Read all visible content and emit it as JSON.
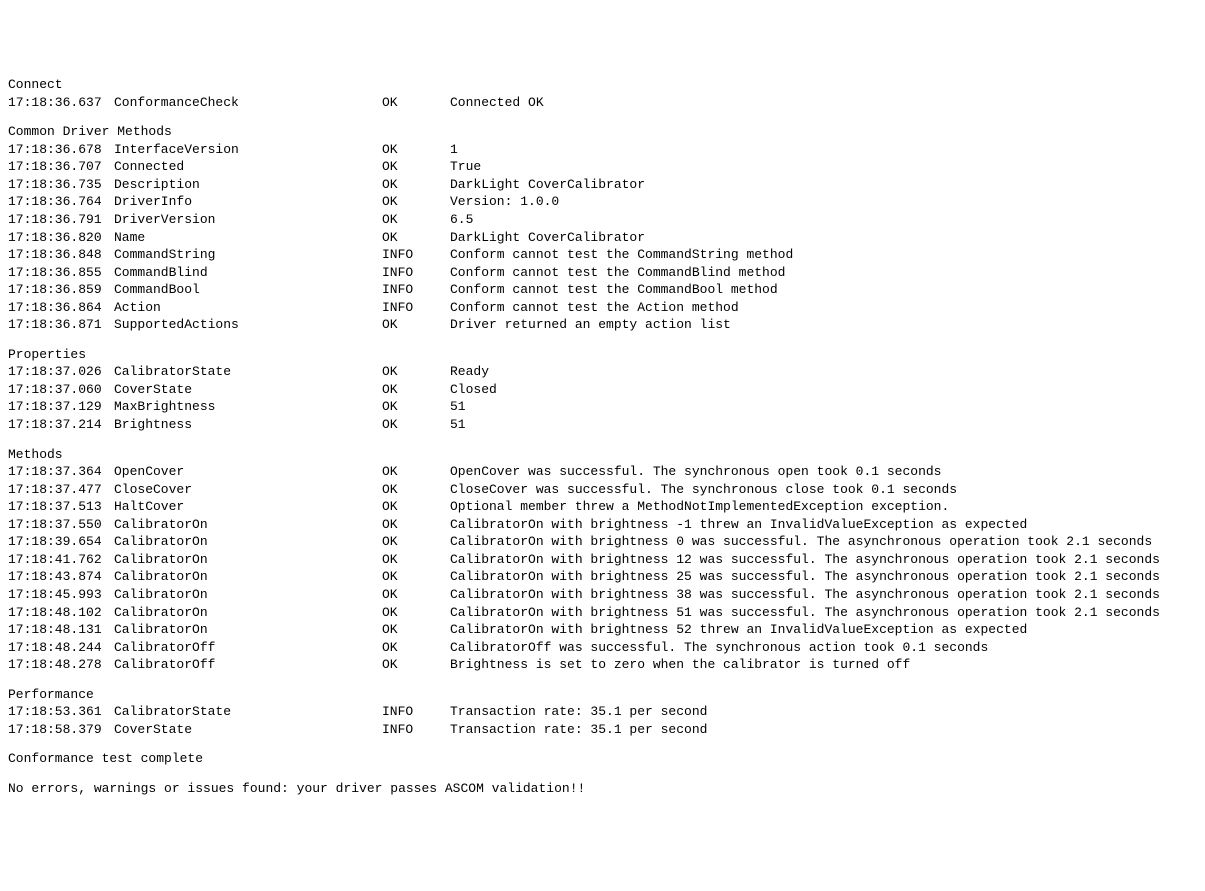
{
  "sections": [
    {
      "header": "Connect",
      "rows": [
        {
          "ts": "17:18:36.637",
          "name": "ConformanceCheck",
          "status": "OK",
          "msg": "Connected OK"
        }
      ]
    },
    {
      "header": "Common Driver Methods",
      "rows": [
        {
          "ts": "17:18:36.678",
          "name": "InterfaceVersion",
          "status": "OK",
          "msg": "1"
        },
        {
          "ts": "17:18:36.707",
          "name": "Connected",
          "status": "OK",
          "msg": "True"
        },
        {
          "ts": "17:18:36.735",
          "name": "Description",
          "status": "OK",
          "msg": "DarkLight CoverCalibrator"
        },
        {
          "ts": "17:18:36.764",
          "name": "DriverInfo",
          "status": "OK",
          "msg": "Version: 1.0.0"
        },
        {
          "ts": "17:18:36.791",
          "name": "DriverVersion",
          "status": "OK",
          "msg": "6.5"
        },
        {
          "ts": "17:18:36.820",
          "name": "Name",
          "status": "OK",
          "msg": "DarkLight CoverCalibrator"
        },
        {
          "ts": "17:18:36.848",
          "name": "CommandString",
          "status": "INFO",
          "msg": "Conform cannot test the CommandString method"
        },
        {
          "ts": "17:18:36.855",
          "name": "CommandBlind",
          "status": "INFO",
          "msg": "Conform cannot test the CommandBlind method"
        },
        {
          "ts": "17:18:36.859",
          "name": "CommandBool",
          "status": "INFO",
          "msg": "Conform cannot test the CommandBool method"
        },
        {
          "ts": "17:18:36.864",
          "name": "Action",
          "status": "INFO",
          "msg": "Conform cannot test the Action method"
        },
        {
          "ts": "17:18:36.871",
          "name": "SupportedActions",
          "status": "OK",
          "msg": "Driver returned an empty action list"
        }
      ]
    },
    {
      "header": "Properties",
      "rows": [
        {
          "ts": "17:18:37.026",
          "name": "CalibratorState",
          "status": "OK",
          "msg": "Ready"
        },
        {
          "ts": "17:18:37.060",
          "name": "CoverState",
          "status": "OK",
          "msg": "Closed"
        },
        {
          "ts": "17:18:37.129",
          "name": "MaxBrightness",
          "status": "OK",
          "msg": "51"
        },
        {
          "ts": "17:18:37.214",
          "name": "Brightness",
          "status": "OK",
          "msg": "51"
        }
      ]
    },
    {
      "header": "Methods",
      "rows": [
        {
          "ts": "17:18:37.364",
          "name": "OpenCover",
          "status": "OK",
          "msg": "OpenCover was successful. The synchronous open took 0.1 seconds"
        },
        {
          "ts": "17:18:37.477",
          "name": "CloseCover",
          "status": "OK",
          "msg": "CloseCover was successful. The synchronous close took 0.1 seconds"
        },
        {
          "ts": "17:18:37.513",
          "name": "HaltCover",
          "status": "OK",
          "msg": "Optional member threw a MethodNotImplementedException exception."
        },
        {
          "ts": "17:18:37.550",
          "name": "CalibratorOn",
          "status": "OK",
          "msg": "CalibratorOn with brightness -1 threw an InvalidValueException as expected"
        },
        {
          "ts": "17:18:39.654",
          "name": "CalibratorOn",
          "status": "OK",
          "msg": "CalibratorOn with brightness 0 was successful. The asynchronous operation took 2.1 seconds"
        },
        {
          "ts": "17:18:41.762",
          "name": "CalibratorOn",
          "status": "OK",
          "msg": "CalibratorOn with brightness 12 was successful. The asynchronous operation took 2.1 seconds"
        },
        {
          "ts": "17:18:43.874",
          "name": "CalibratorOn",
          "status": "OK",
          "msg": "CalibratorOn with brightness 25 was successful. The asynchronous operation took 2.1 seconds"
        },
        {
          "ts": "17:18:45.993",
          "name": "CalibratorOn",
          "status": "OK",
          "msg": "CalibratorOn with brightness 38 was successful. The asynchronous operation took 2.1 seconds"
        },
        {
          "ts": "17:18:48.102",
          "name": "CalibratorOn",
          "status": "OK",
          "msg": "CalibratorOn with brightness 51 was successful. The asynchronous operation took 2.1 seconds"
        },
        {
          "ts": "17:18:48.131",
          "name": "CalibratorOn",
          "status": "OK",
          "msg": "CalibratorOn with brightness 52 threw an InvalidValueException as expected"
        },
        {
          "ts": "17:18:48.244",
          "name": "CalibratorOff",
          "status": "OK",
          "msg": "CalibratorOff was successful. The synchronous action took 0.1 seconds"
        },
        {
          "ts": "17:18:48.278",
          "name": "CalibratorOff",
          "status": "OK",
          "msg": "Brightness is set to zero when the calibrator is turned off"
        }
      ]
    },
    {
      "header": "Performance",
      "rows": [
        {
          "ts": "17:18:53.361",
          "name": "CalibratorState",
          "status": "INFO",
          "msg": "Transaction rate: 35.1 per second"
        },
        {
          "ts": "17:18:58.379",
          "name": "CoverState",
          "status": "INFO",
          "msg": "Transaction rate: 35.1 per second"
        }
      ]
    }
  ],
  "footer": {
    "complete": "Conformance test complete",
    "summary": "No errors, warnings or issues found: your driver passes ASCOM validation!!"
  }
}
